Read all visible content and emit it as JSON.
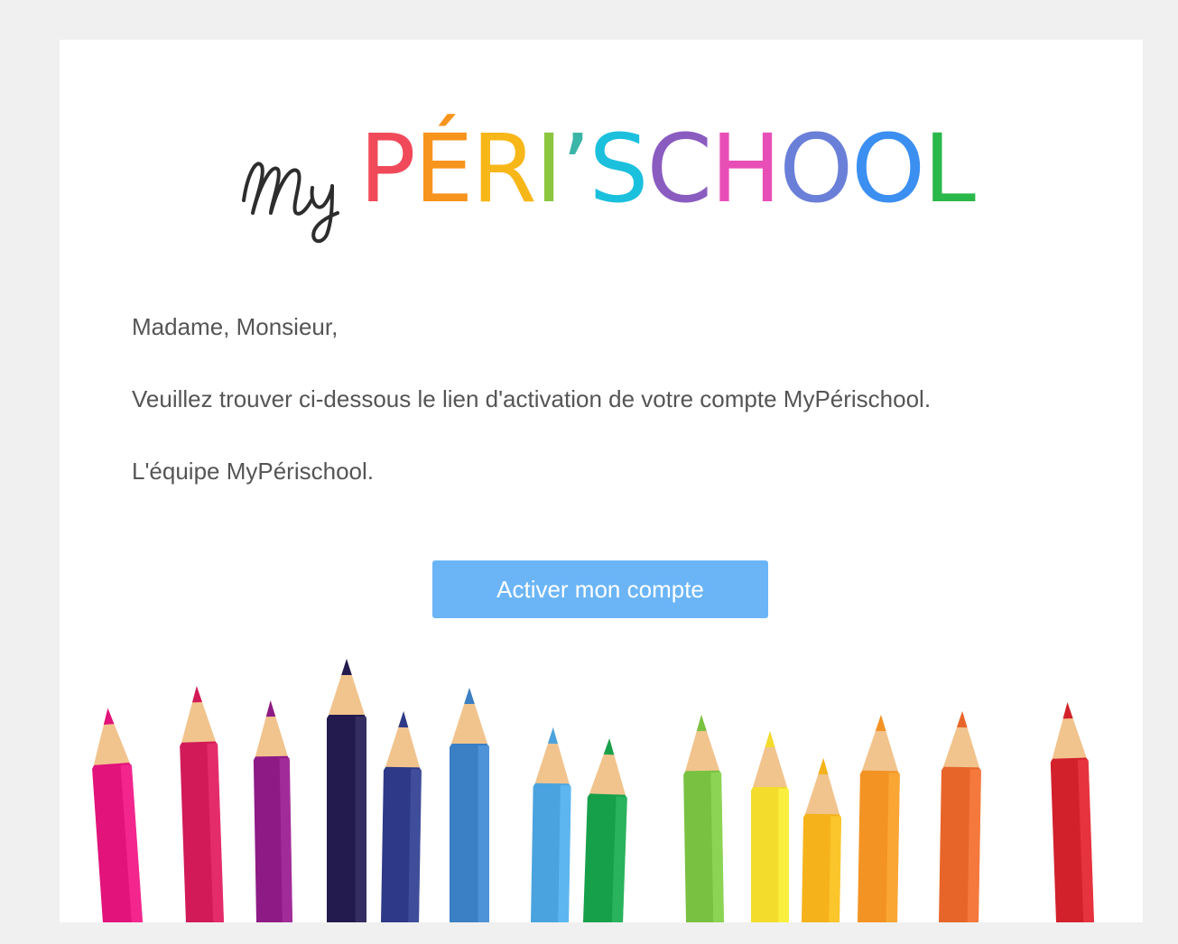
{
  "logo": {
    "script_text": "My",
    "letters": [
      {
        "char": "P",
        "color": "#f04a5a"
      },
      {
        "char": "É",
        "color": "#f7941d"
      },
      {
        "char": "R",
        "color": "#f7b718"
      },
      {
        "char": "I",
        "color": "#8dc63f"
      },
      {
        "char": "’",
        "color": "#3bb5a8"
      },
      {
        "char": "S",
        "color": "#1bc0dd"
      },
      {
        "char": "C",
        "color": "#8a5cc0"
      },
      {
        "char": "H",
        "color": "#e84fb6"
      },
      {
        "char": "O",
        "color": "#6a7fd8"
      },
      {
        "char": "O",
        "color": "#3b8ff0"
      },
      {
        "char": "L",
        "color": "#2bb84a"
      }
    ]
  },
  "message": {
    "greeting": "Madame, Monsieur,",
    "body": "Veuillez trouver ci-dessous le lien d'activation de votre compte MyPérischool.",
    "signature": "L'équipe MyPérischool."
  },
  "cta": {
    "label": "Activer mon compte",
    "color": "#6bb5f7"
  },
  "pencil_colors": [
    "#e2137a",
    "#d11a57",
    "#8e1a86",
    "#231b4e",
    "#2e3a87",
    "#3b7fc4",
    "#4aa3de",
    "#17a04a",
    "#79c141",
    "#f3dc2c",
    "#f5b21a",
    "#f39323",
    "#e8652a",
    "#d2212b"
  ]
}
